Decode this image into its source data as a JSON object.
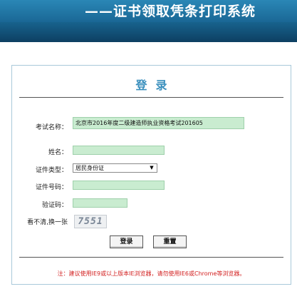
{
  "header": {
    "title": "——证书领取凭条打印系统"
  },
  "panel": {
    "title": "登录",
    "fields": {
      "exam_name": {
        "label": "考试名称：",
        "value": "北京市2016年度二级建造师执业资格考试201605"
      },
      "name": {
        "label": "姓名：",
        "value": ""
      },
      "id_type": {
        "label": "证件类型：",
        "value": "居民身份证"
      },
      "id_number": {
        "label": "证件号码：",
        "value": ""
      },
      "captcha": {
        "label": "验证码：",
        "value": ""
      }
    },
    "refresh_captcha_label": "看不清,换一张",
    "captcha_image_text": "7551",
    "login_button": "登录",
    "reset_button": "重置",
    "note": "注：建议使用IE9或以上版本IE浏览器，请勿使用IE6或Chrome等浏览器。"
  },
  "colors": {
    "banner": "#1a6795",
    "title_accent": "#3a8fbd",
    "field_bg": "#c9ecd0",
    "note_text": "#d21f1f"
  }
}
